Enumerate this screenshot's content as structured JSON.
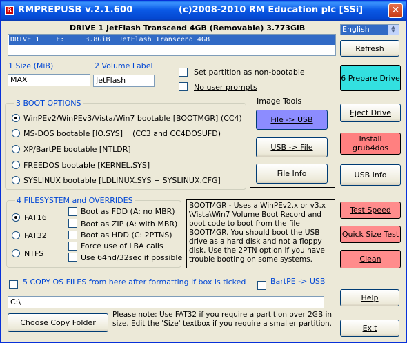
{
  "window": {
    "title": "RMPREPUSB v.2.1.600",
    "copyright": "(c)2008-2010 RM Education plc [SSi]",
    "close": "✕"
  },
  "drive": {
    "header": "DRIVE 1 JetFlash Transcend 4GB  (Removable) 3.773GiB",
    "list_row": "DRIVE 1    F:     3.8GiB  JetFlash Transcend 4GB"
  },
  "language": {
    "selected": "English"
  },
  "size": {
    "label": "1 Size (MiB)",
    "value": "MAX"
  },
  "volume": {
    "label": "2 Volume Label",
    "value": "JetFlash"
  },
  "options": {
    "non_bootable": "Set partition as non-bootable",
    "no_prompts": "No user prompts"
  },
  "boot_options": {
    "legend": "3 BOOT OPTIONS",
    "items": [
      "WinPEv2/WinPEv3/Vista/Win7 bootable [BOOTMGR] (CC4)",
      "MS-DOS bootable [IO.SYS]    (CC3 and CC4DOSUFD)",
      "XP/BartPE bootable [NTLDR]",
      "FREEDOS bootable [KERNEL.SYS]",
      "SYSLINUX bootable [LDLINUX.SYS + SYSLINUX.CFG]"
    ]
  },
  "image_tools": {
    "legend": "Image Tools",
    "file_to_usb": "File -> USB",
    "usb_to_file": "USB -> File",
    "file_info": "File Info"
  },
  "filesystem": {
    "legend": "4 FILESYSTEM and OVERRIDES",
    "fs": [
      "FAT16",
      "FAT32",
      "NTFS"
    ],
    "overrides": [
      "Boot as FDD (A: no MBR)",
      "Boot as ZIP (A: with MBR)",
      "Boot as HDD (C: 2PTNS)",
      "Force use of LBA calls",
      "Use 64hd/32sec if possible"
    ]
  },
  "info_text": "BOOTMGR - Uses a WinPEv2.x or v3.x \\Vista\\Win7 Volume Boot Record and boot code to boot from the file BOOTMGR. You should boot the USB drive as a hard disk and not a floppy disk. Use the 2PTN option if you have trouble booting on some systems.",
  "copy_files": {
    "label": "5 COPY OS FILES from here after formatting if box is ticked",
    "bartpe": "BartPE -> USB",
    "path": "C:\\",
    "choose": "Choose Copy Folder"
  },
  "note": "Please note: Use FAT32 if you require a partition over 2GB in size. Edit the 'Size' textbox if you require a smaller partition.",
  "buttons": {
    "refresh": "Refresh",
    "prepare": "6 Prepare Drive",
    "eject": "Eject Drive",
    "grub": "Install grub4dos",
    "usb_info": "USB Info",
    "test_speed": "Test Speed",
    "quick_size": "Quick Size Test",
    "clean": "Clean",
    "help": "Help",
    "exit": "Exit"
  },
  "colors": {
    "prepare_bg": "#33e0e0",
    "file_usb_bg": "#8c8cff",
    "red_btn_bg": "#ff8c8c",
    "grub_bg": "#ff8080"
  }
}
